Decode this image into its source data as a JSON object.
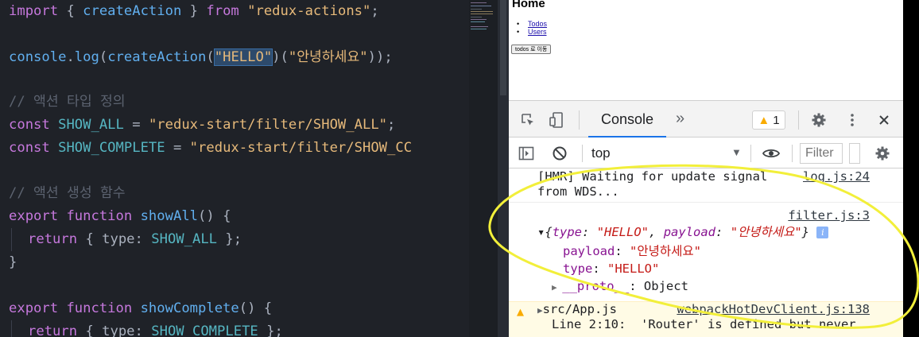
{
  "editor": {
    "line1": {
      "kw1": "import",
      "p1": " { ",
      "fn": "createAction",
      "p2": " } ",
      "kw2": "from",
      "p3": " ",
      "str": "\"redux-actions\"",
      "p4": ";"
    },
    "line2": {
      "obj": "console",
      "p1": ".",
      "fn": "log",
      "p2": "(",
      "fn2": "createAction",
      "p3": "(",
      "sel": "\"HELLO\"",
      "p4": ")(",
      "str": "\"안녕하세요\"",
      "p5": "));"
    },
    "comment1": "// 액션 타입 정의",
    "line4": {
      "kw": "const",
      "name": " SHOW_ALL ",
      "eq": "= ",
      "str": "\"redux-start/filter/SHOW_ALL\"",
      "end": ";"
    },
    "line5": {
      "kw": "const",
      "name": " SHOW_COMPLETE ",
      "eq": "= ",
      "str": "\"redux-start/filter/SHOW_CC"
    },
    "comment2": "// 액션 생성 함수",
    "line7": {
      "kw1": "export",
      "kw2": " function",
      "fn": " showAll",
      "p": "() {"
    },
    "line8": {
      "kw": "return",
      "p1": " { ",
      "key": "type",
      "p2": ": ",
      "val": "SHOW_ALL",
      "p3": " };"
    },
    "line9": "}",
    "line10": {
      "kw1": "export",
      "kw2": " function",
      "fn": " showComplete",
      "p": "() {"
    },
    "line11": {
      "kw": "return",
      "p1": " { ",
      "key": "type",
      "p2": ": ",
      "val": "SHOW_COMPLETE",
      "p3": " };"
    }
  },
  "page": {
    "title": "Home",
    "links": [
      "Todos",
      "Users"
    ],
    "button_label": "todos 로 이동"
  },
  "devtools": {
    "tab_console": "Console",
    "tab_more": "»",
    "warning_count": "1",
    "context": "top",
    "filter_placeholder": "Filter",
    "messages": {
      "hmr_line1": "[HMR] Waiting for update signal",
      "hmr_line2": "from WDS...",
      "hmr_src": "log.js:24",
      "obj_src": "filter.js:3",
      "obj_summary_open": "{",
      "obj_key_type": "type",
      "obj_val_hello": "\"HELLO\"",
      "obj_key_payload": "payload",
      "obj_val_korean": "\"안녕하세요\"",
      "obj_summary_close": "}",
      "info_icon": "i",
      "payload_key": "payload",
      "payload_val": "\"안녕하세요\"",
      "type_key": "type",
      "type_val": "\"HELLO\"",
      "proto_key": "__proto__",
      "proto_val": "Object",
      "warn_file": "src/App.js",
      "warn_src": "webpackHotDevClient.js:138",
      "warn_line": "Line 2:10:  'Router' is defined but never"
    }
  },
  "colors": {
    "annotation": "#f2ef3a",
    "editor_bg": "#1f2228",
    "warning_bg": "#fffbe5"
  }
}
